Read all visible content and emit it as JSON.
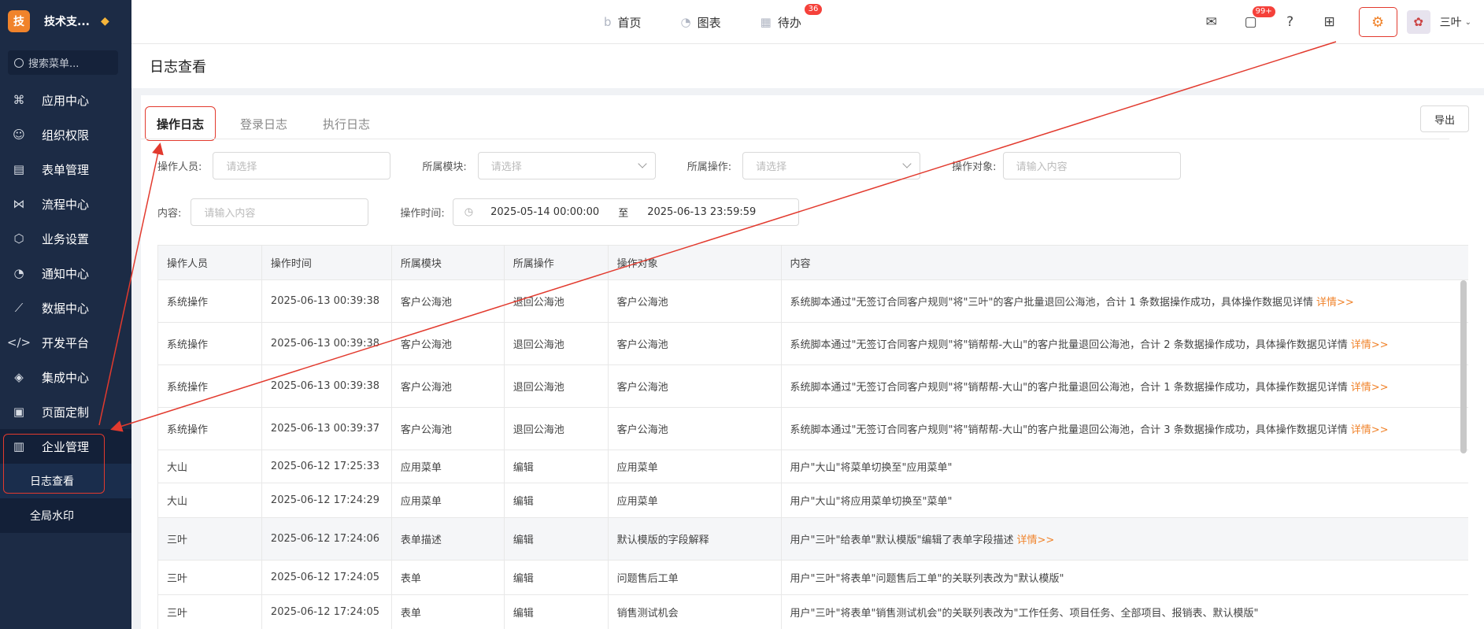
{
  "brand": {
    "logo_char": "技",
    "name": "技术支...",
    "accent": "#f0832b"
  },
  "sidebar": {
    "search_placeholder": "搜索菜单...",
    "items": [
      {
        "label": "应用中心",
        "icon": "apps-icon"
      },
      {
        "label": "组织权限",
        "icon": "user-icon"
      },
      {
        "label": "表单管理",
        "icon": "form-icon"
      },
      {
        "label": "流程中心",
        "icon": "flow-icon"
      },
      {
        "label": "业务设置",
        "icon": "cube-icon"
      },
      {
        "label": "通知中心",
        "icon": "bell-icon"
      },
      {
        "label": "数据中心",
        "icon": "chart-line-icon"
      },
      {
        "label": "开发平台",
        "icon": "code-icon"
      },
      {
        "label": "集成中心",
        "icon": "layers-icon"
      },
      {
        "label": "页面定制",
        "icon": "page-icon"
      },
      {
        "label": "企业管理",
        "icon": "building-icon"
      }
    ],
    "sub_items": [
      {
        "label": "日志查看"
      },
      {
        "label": "全局水印"
      }
    ]
  },
  "topbar": {
    "nav": [
      {
        "label": "首页",
        "icon": "b-icon"
      },
      {
        "label": "图表",
        "icon": "pie-icon"
      },
      {
        "label": "待办",
        "icon": "calendar-icon",
        "badge": "36"
      }
    ],
    "chat_badge": "99+",
    "user_name": "三叶"
  },
  "page": {
    "title": "日志查看"
  },
  "tabs": [
    {
      "label": "操作日志"
    },
    {
      "label": "登录日志"
    },
    {
      "label": "执行日志"
    }
  ],
  "export_label": "导出",
  "filters": {
    "operator_label": "操作人员:",
    "operator_placeholder": "请选择",
    "module_label": "所属模块:",
    "module_placeholder": "请选择",
    "action_label": "所属操作:",
    "action_placeholder": "请选择",
    "target_label": "操作对象:",
    "target_placeholder": "请输入内容",
    "content_label": "内容:",
    "content_placeholder": "请输入内容",
    "time_label": "操作时间:",
    "time_start": "2025-05-14 00:00:00",
    "time_sep": "至",
    "time_end": "2025-06-13 23:59:59"
  },
  "table": {
    "headers": [
      "操作人员",
      "操作时间",
      "所属模块",
      "所属操作",
      "操作对象",
      "内容"
    ],
    "detail_label": "详情>>",
    "rows": [
      {
        "operator": "系统操作",
        "time": "2025-06-13 00:39:38",
        "module": "客户公海池",
        "action": "退回公海池",
        "target": "客户公海池",
        "content": "系统脚本通过\"无签订合同客户规则\"将\"三叶\"的客户批量退回公海池，合计 1 条数据操作成功，具体操作数据见详情",
        "has_detail": true
      },
      {
        "operator": "系统操作",
        "time": "2025-06-13 00:39:38",
        "module": "客户公海池",
        "action": "退回公海池",
        "target": "客户公海池",
        "content": "系统脚本通过\"无签订合同客户规则\"将\"销帮帮-大山\"的客户批量退回公海池，合计 2 条数据操作成功，具体操作数据见详情",
        "has_detail": true
      },
      {
        "operator": "系统操作",
        "time": "2025-06-13 00:39:38",
        "module": "客户公海池",
        "action": "退回公海池",
        "target": "客户公海池",
        "content": "系统脚本通过\"无签订合同客户规则\"将\"销帮帮-大山\"的客户批量退回公海池，合计 1 条数据操作成功，具体操作数据见详情",
        "has_detail": true
      },
      {
        "operator": "系统操作",
        "time": "2025-06-13 00:39:37",
        "module": "客户公海池",
        "action": "退回公海池",
        "target": "客户公海池",
        "content": "系统脚本通过\"无签订合同客户规则\"将\"销帮帮-大山\"的客户批量退回公海池，合计 3 条数据操作成功，具体操作数据见详情",
        "has_detail": true
      },
      {
        "operator": "大山",
        "time": "2025-06-12 17:25:33",
        "module": "应用菜单",
        "action": "编辑",
        "target": "应用菜单",
        "content": "用户\"大山\"将菜单切换至\"应用菜单\"",
        "has_detail": false
      },
      {
        "operator": "大山",
        "time": "2025-06-12 17:24:29",
        "module": "应用菜单",
        "action": "编辑",
        "target": "应用菜单",
        "content": "用户\"大山\"将应用菜单切换至\"菜单\"",
        "has_detail": false
      },
      {
        "operator": "三叶",
        "time": "2025-06-12 17:24:06",
        "module": "表单描述",
        "action": "编辑",
        "target": "默认模版的字段解释",
        "content": "用户\"三叶\"给表单\"默认模版\"编辑了表单字段描述",
        "has_detail": true
      },
      {
        "operator": "三叶",
        "time": "2025-06-12 17:24:05",
        "module": "表单",
        "action": "编辑",
        "target": "问题售后工单",
        "content": "用户\"三叶\"将表单\"问题售后工单\"的关联列表改为\"默认模版\"",
        "has_detail": false
      },
      {
        "operator": "三叶",
        "time": "2025-06-12 17:24:05",
        "module": "表单",
        "action": "编辑",
        "target": "销售测试机会",
        "content": "用户\"三叶\"将表单\"销售测试机会\"的关联列表改为\"工作任务、项目任务、全部项目、报销表、默认模版\"",
        "has_detail": false
      }
    ]
  },
  "colors": {
    "sidebar_bg": "#1c2b45",
    "accent": "#f0832b",
    "annotation": "#e23a2e",
    "badge": "#f5413a"
  }
}
